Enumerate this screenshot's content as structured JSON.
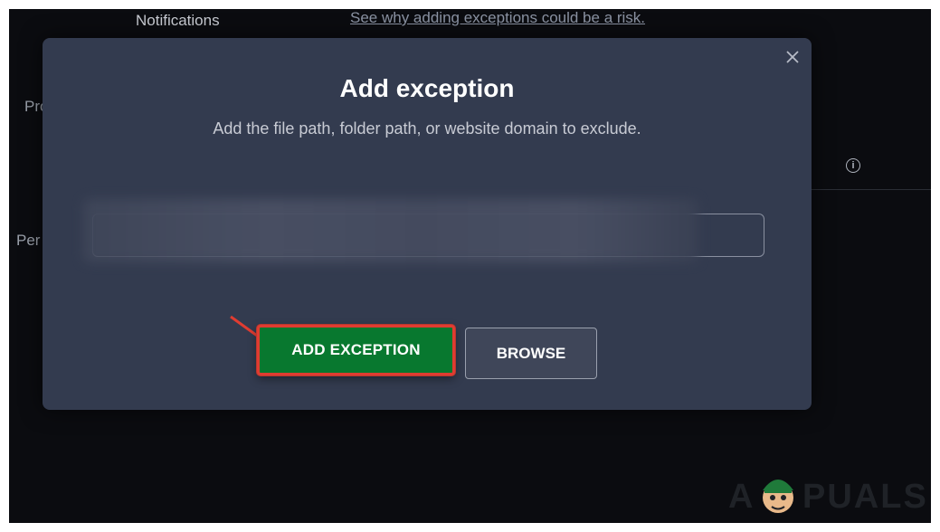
{
  "background": {
    "nav_notifications": "Notifications",
    "risk_link": "See why adding exceptions could be a risk.",
    "left_label_1": "Pro",
    "left_label_2": "Per"
  },
  "modal": {
    "title": "Add exception",
    "subtitle": "Add the file path, folder path, or website domain to exclude.",
    "input_value": "",
    "add_button_label": "ADD EXCEPTION",
    "browse_button_label": "BROWSE",
    "close_icon": "close-icon"
  },
  "watermark": {
    "text_a": "A",
    "text_puals": "PUALS"
  },
  "colors": {
    "modal_bg": "#333b4f",
    "add_button": "#08782f",
    "highlight": "#e03c31"
  }
}
